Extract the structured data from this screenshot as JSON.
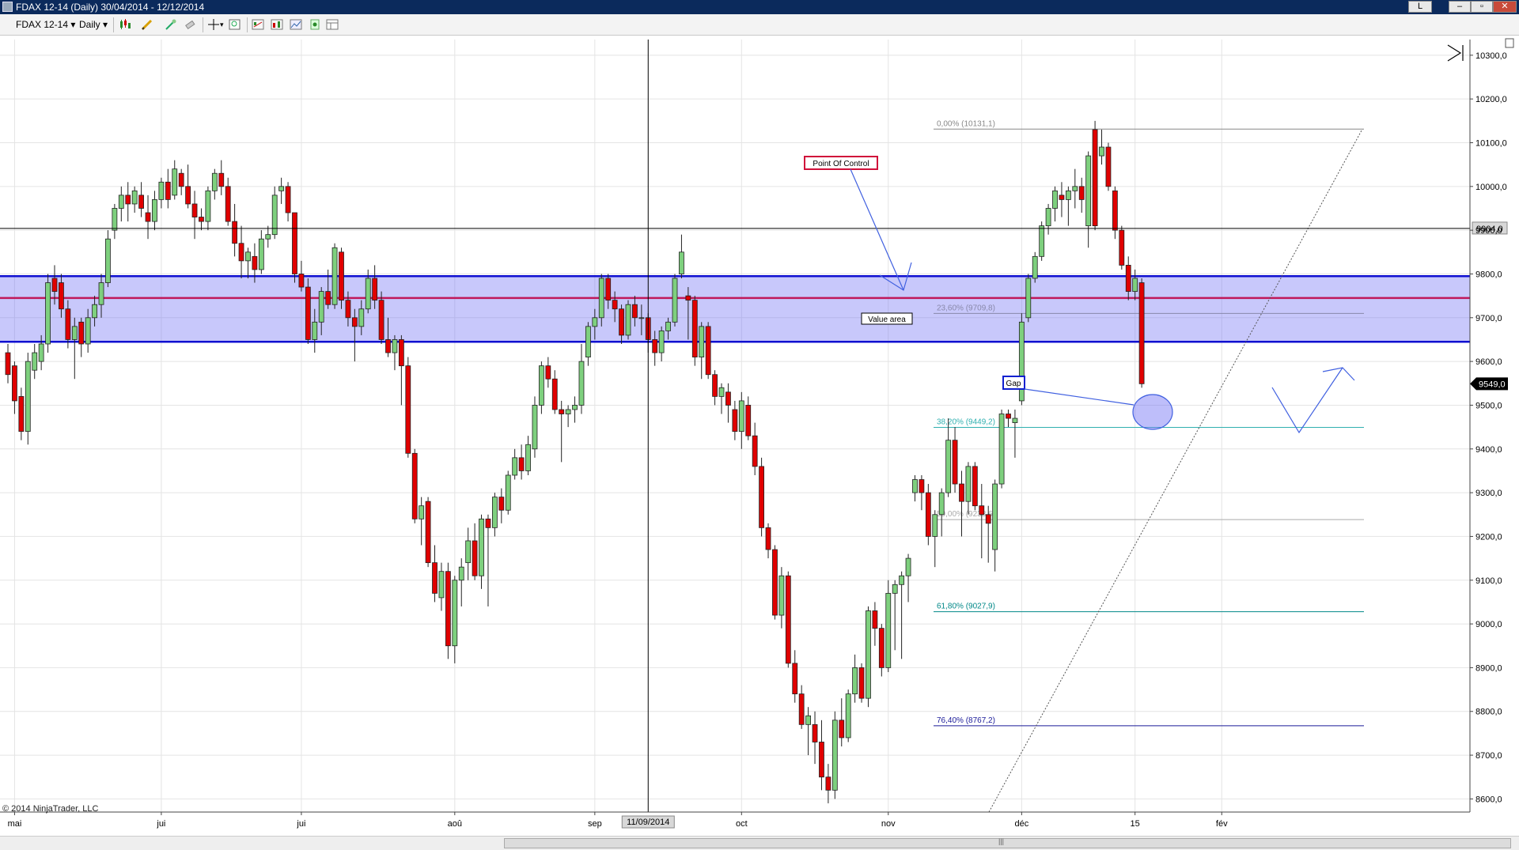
{
  "window": {
    "title": "FDAX 12-14 (Daily)  30/04/2014 - 12/12/2014",
    "buttons": [
      "L",
      "–",
      "▫",
      "✕"
    ]
  },
  "toolbar": {
    "instrument": "FDAX 12-14",
    "interval": "Daily",
    "icons": [
      "candlestick-icon",
      "pencil-icon",
      "wand-icon",
      "eraser-icon",
      "crosshair-icon",
      "zoom-icon",
      "strategy-icon",
      "indicator-icon",
      "properties-icon",
      "data-box-icon",
      "layout-icon"
    ]
  },
  "chart_data": {
    "type": "candlestick",
    "instrument": "FDAX 12-14",
    "period": "Daily",
    "ylim": [
      8570,
      10325
    ],
    "yticks": [
      8600,
      8700,
      8800,
      8900,
      9000,
      9100,
      9200,
      9300,
      9400,
      9500,
      9600,
      9700,
      9800,
      9900,
      10000,
      10100,
      10200,
      10300
    ],
    "ytick_labels": [
      "8600,0",
      "8700,0",
      "8800,0",
      "8900,0",
      "9000,0",
      "9100,0",
      "9200,0",
      "9300,0",
      "9400,0",
      "9500,0",
      "9600,0",
      "9700,0",
      "9800,0",
      "9900,0",
      "10000,0",
      "10100,0",
      "10200,0",
      "10300,0"
    ],
    "xticks": [
      {
        "label": "mai",
        "index": 1
      },
      {
        "label": "jui",
        "index": 23
      },
      {
        "label": "jui",
        "index": 44
      },
      {
        "label": "aoû",
        "index": 67
      },
      {
        "label": "sep",
        "index": 88
      },
      {
        "label": "oct",
        "index": 110
      },
      {
        "label": "nov",
        "index": 132
      },
      {
        "label": "déc",
        "index": 152
      },
      {
        "label": "15",
        "index": 169
      },
      {
        "label": "fév",
        "index": 182
      }
    ],
    "cursor_date": "11/09/2014",
    "cursor_index": 96,
    "cursor_price": 9904,
    "cursor_price_label": "9904,0",
    "last_price": 9549,
    "last_price_label": "9549,0",
    "value_area": {
      "label": "Value area",
      "high": 9795,
      "low": 9645
    },
    "point_of_control": {
      "label": "Point Of Control",
      "price": 9745
    },
    "fibonacci": [
      {
        "label": "0,00% (10131,1)",
        "price": 10131.1,
        "color": "#888888"
      },
      {
        "label": "23,60% (9709,8)",
        "price": 9709.8,
        "color": "#8888aa"
      },
      {
        "label": "38,20% (9449,2)",
        "price": 9449.2,
        "color": "#30b0b0"
      },
      {
        "label": "50,00% (9238,6)",
        "price": 9238.6,
        "color": "#aaaaaa"
      },
      {
        "label": "61,80% (9027,9)",
        "price": 9027.9,
        "color": "#008888"
      },
      {
        "label": "76,40% (8767,2)",
        "price": 8767.2,
        "color": "#1a1a99"
      }
    ],
    "gap": {
      "label": "Gap"
    },
    "copyright": "© 2014 NinjaTrader, LLC",
    "candles": [
      [
        9620,
        9640,
        9550,
        9570
      ],
      [
        9590,
        9600,
        9480,
        9510
      ],
      [
        9520,
        9540,
        9420,
        9440
      ],
      [
        9440,
        9620,
        9410,
        9600
      ],
      [
        9580,
        9640,
        9560,
        9620
      ],
      [
        9600,
        9660,
        9580,
        9640
      ],
      [
        9640,
        9800,
        9620,
        9780
      ],
      [
        9790,
        9820,
        9730,
        9760
      ],
      [
        9780,
        9800,
        9700,
        9720
      ],
      [
        9720,
        9740,
        9630,
        9650
      ],
      [
        9650,
        9700,
        9560,
        9680
      ],
      [
        9690,
        9700,
        9610,
        9640
      ],
      [
        9640,
        9720,
        9620,
        9700
      ],
      [
        9700,
        9750,
        9680,
        9730
      ],
      [
        9730,
        9800,
        9700,
        9780
      ],
      [
        9780,
        9900,
        9770,
        9880
      ],
      [
        9900,
        9960,
        9880,
        9950
      ],
      [
        9950,
        10000,
        9920,
        9980
      ],
      [
        9980,
        10010,
        9920,
        9960
      ],
      [
        9960,
        10000,
        9940,
        9990
      ],
      [
        9980,
        10010,
        9930,
        9950
      ],
      [
        9940,
        9980,
        9880,
        9920
      ],
      [
        9920,
        9990,
        9900,
        9970
      ],
      [
        9970,
        10020,
        9950,
        10010
      ],
      [
        10010,
        10040,
        9950,
        9970
      ],
      [
        9980,
        10060,
        9970,
        10040
      ],
      [
        10030,
        10040,
        9980,
        10000
      ],
      [
        10000,
        10050,
        9950,
        9960
      ],
      [
        9960,
        9990,
        9880,
        9930
      ],
      [
        9930,
        9950,
        9900,
        9920
      ],
      [
        9920,
        10000,
        9900,
        9990
      ],
      [
        9990,
        10040,
        9970,
        10030
      ],
      [
        10030,
        10060,
        9980,
        10000
      ],
      [
        10000,
        10020,
        9910,
        9920
      ],
      [
        9920,
        9960,
        9840,
        9870
      ],
      [
        9870,
        9910,
        9790,
        9830
      ],
      [
        9830,
        9860,
        9790,
        9850
      ],
      [
        9840,
        9870,
        9780,
        9810
      ],
      [
        9810,
        9900,
        9800,
        9880
      ],
      [
        9880,
        9910,
        9860,
        9890
      ],
      [
        9890,
        10000,
        9880,
        9980
      ],
      [
        9990,
        10020,
        9960,
        10000
      ],
      [
        10000,
        10010,
        9920,
        9940
      ],
      [
        9940,
        9940,
        9780,
        9800
      ],
      [
        9800,
        9830,
        9760,
        9770
      ],
      [
        9770,
        9790,
        9640,
        9650
      ],
      [
        9650,
        9720,
        9620,
        9690
      ],
      [
        9690,
        9770,
        9660,
        9760
      ],
      [
        9760,
        9810,
        9720,
        9730
      ],
      [
        9730,
        9870,
        9720,
        9860
      ],
      [
        9850,
        9860,
        9720,
        9740
      ],
      [
        9740,
        9760,
        9680,
        9700
      ],
      [
        9700,
        9720,
        9600,
        9680
      ],
      [
        9680,
        9740,
        9660,
        9720
      ],
      [
        9720,
        9810,
        9710,
        9790
      ],
      [
        9790,
        9820,
        9720,
        9740
      ],
      [
        9740,
        9760,
        9640,
        9650
      ],
      [
        9650,
        9700,
        9610,
        9620
      ],
      [
        9620,
        9660,
        9580,
        9650
      ],
      [
        9650,
        9660,
        9500,
        9590
      ],
      [
        9590,
        9610,
        9380,
        9390
      ],
      [
        9390,
        9400,
        9230,
        9240
      ],
      [
        9240,
        9290,
        9180,
        9270
      ],
      [
        9280,
        9290,
        9130,
        9140
      ],
      [
        9140,
        9180,
        9050,
        9070
      ],
      [
        9060,
        9140,
        9030,
        9120
      ],
      [
        9120,
        9140,
        8920,
        8950
      ],
      [
        8950,
        9110,
        8910,
        9100
      ],
      [
        9100,
        9150,
        9040,
        9130
      ],
      [
        9140,
        9220,
        9100,
        9190
      ],
      [
        9190,
        9230,
        9100,
        9110
      ],
      [
        9110,
        9250,
        9080,
        9240
      ],
      [
        9240,
        9250,
        9040,
        9220
      ],
      [
        9220,
        9300,
        9200,
        9290
      ],
      [
        9290,
        9310,
        9230,
        9260
      ],
      [
        9260,
        9350,
        9250,
        9340
      ],
      [
        9340,
        9400,
        9330,
        9380
      ],
      [
        9380,
        9410,
        9330,
        9350
      ],
      [
        9350,
        9430,
        9340,
        9410
      ],
      [
        9400,
        9520,
        9380,
        9500
      ],
      [
        9500,
        9600,
        9480,
        9590
      ],
      [
        9590,
        9610,
        9540,
        9560
      ],
      [
        9560,
        9580,
        9480,
        9490
      ],
      [
        9490,
        9510,
        9370,
        9480
      ],
      [
        9480,
        9500,
        9450,
        9490
      ],
      [
        9490,
        9520,
        9460,
        9500
      ],
      [
        9500,
        9640,
        9480,
        9600
      ],
      [
        9610,
        9690,
        9590,
        9680
      ],
      [
        9680,
        9720,
        9650,
        9700
      ],
      [
        9700,
        9800,
        9680,
        9790
      ],
      [
        9790,
        9800,
        9720,
        9740
      ],
      [
        9740,
        9760,
        9690,
        9720
      ],
      [
        9720,
        9730,
        9640,
        9660
      ],
      [
        9660,
        9740,
        9650,
        9730
      ],
      [
        9730,
        9750,
        9680,
        9700
      ],
      [
        9700,
        9730,
        9660,
        9700
      ],
      [
        9700,
        9710,
        9620,
        9650
      ],
      [
        9650,
        9670,
        9590,
        9620
      ],
      [
        9620,
        9680,
        9600,
        9670
      ],
      [
        9670,
        9700,
        9650,
        9690
      ],
      [
        9690,
        9800,
        9680,
        9790
      ],
      [
        9800,
        9890,
        9790,
        9850
      ],
      [
        9750,
        9770,
        9650,
        9740
      ],
      [
        9740,
        9750,
        9590,
        9610
      ],
      [
        9610,
        9690,
        9560,
        9680
      ],
      [
        9680,
        9690,
        9560,
        9570
      ],
      [
        9570,
        9580,
        9500,
        9520
      ],
      [
        9520,
        9550,
        9480,
        9540
      ],
      [
        9530,
        9550,
        9460,
        9500
      ],
      [
        9490,
        9510,
        9420,
        9440
      ],
      [
        9440,
        9530,
        9400,
        9510
      ],
      [
        9500,
        9520,
        9420,
        9430
      ],
      [
        9430,
        9460,
        9340,
        9360
      ],
      [
        9360,
        9380,
        9200,
        9220
      ],
      [
        9220,
        9230,
        9150,
        9170
      ],
      [
        9170,
        9180,
        9010,
        9020
      ],
      [
        9020,
        9130,
        8990,
        9110
      ],
      [
        9110,
        9120,
        8900,
        8910
      ],
      [
        8910,
        8940,
        8820,
        8840
      ],
      [
        8840,
        8860,
        8760,
        8770
      ],
      [
        8770,
        8810,
        8700,
        8790
      ],
      [
        8770,
        8800,
        8680,
        8730
      ],
      [
        8730,
        8780,
        8620,
        8650
      ],
      [
        8650,
        8680,
        8590,
        8620
      ],
      [
        8620,
        8800,
        8600,
        8780
      ],
      [
        8780,
        8830,
        8720,
        8740
      ],
      [
        8740,
        8850,
        8730,
        8840
      ],
      [
        8840,
        8930,
        8820,
        8900
      ],
      [
        8900,
        8910,
        8820,
        8830
      ],
      [
        8830,
        9040,
        8810,
        9030
      ],
      [
        9030,
        9050,
        8950,
        8990
      ],
      [
        8990,
        9000,
        8880,
        8900
      ],
      [
        8900,
        9100,
        8890,
        9070
      ],
      [
        9070,
        9100,
        8940,
        9090
      ],
      [
        9090,
        9120,
        8920,
        9110
      ],
      [
        9110,
        9160,
        9050,
        9150
      ],
      [
        9300,
        9340,
        9280,
        9330
      ],
      [
        9330,
        9340,
        9260,
        9300
      ],
      [
        9300,
        9320,
        9180,
        9200
      ],
      [
        9200,
        9260,
        9130,
        9250
      ],
      [
        9250,
        9310,
        9200,
        9300
      ],
      [
        9300,
        9470,
        9290,
        9420
      ],
      [
        9420,
        9450,
        9300,
        9320
      ],
      [
        9320,
        9350,
        9200,
        9280
      ],
      [
        9280,
        9370,
        9250,
        9360
      ],
      [
        9360,
        9370,
        9260,
        9270
      ],
      [
        9270,
        9320,
        9150,
        9250
      ],
      [
        9250,
        9270,
        9140,
        9230
      ],
      [
        9170,
        9330,
        9120,
        9320
      ],
      [
        9320,
        9490,
        9310,
        9480
      ],
      [
        9480,
        9490,
        9450,
        9470
      ],
      [
        9460,
        9490,
        9380,
        9470
      ],
      [
        9510,
        9710,
        9500,
        9690
      ],
      [
        9700,
        9800,
        9690,
        9790
      ],
      [
        9790,
        9850,
        9780,
        9840
      ],
      [
        9840,
        9920,
        9830,
        9910
      ],
      [
        9910,
        9960,
        9890,
        9950
      ],
      [
        9950,
        10000,
        9920,
        9990
      ],
      [
        9980,
        10010,
        9930,
        9970
      ],
      [
        9970,
        10000,
        9910,
        9990
      ],
      [
        9990,
        10040,
        9950,
        10000
      ],
      [
        10000,
        10020,
        9940,
        9970
      ],
      [
        9910,
        10080,
        9860,
        10070
      ],
      [
        10130,
        10150,
        9900,
        9910
      ],
      [
        10070,
        10130,
        10050,
        10090
      ],
      [
        10090,
        10100,
        9990,
        10000
      ],
      [
        9990,
        10000,
        9880,
        9900
      ],
      [
        9900,
        9910,
        9810,
        9820
      ],
      [
        9820,
        9840,
        9740,
        9760
      ],
      [
        9760,
        9810,
        9740,
        9790
      ],
      [
        9780,
        9790,
        9540,
        9549
      ]
    ]
  }
}
